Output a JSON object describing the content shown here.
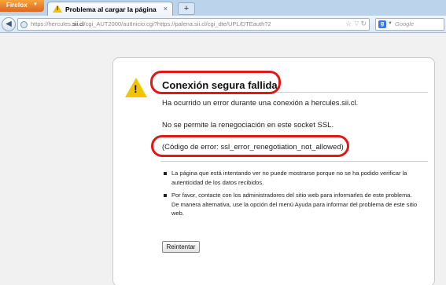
{
  "browser": {
    "app_button_label": "Firefox",
    "tab_title": "Problema al cargar la página",
    "new_tab_label": "+",
    "url_host_prefix": "https://hercules.",
    "url_host_bold": "sii.cl",
    "url_path": "/cgi_AUT2000/autInicio.cgi?https://palena.sii.cl/cgi_dte/UPL/DTEauth?2",
    "search_placeholder": "Google"
  },
  "error_page": {
    "title": "Conexión segura fallida",
    "line1": "Ha ocurrido un error durante una conexión a hercules.sii.cl.",
    "line2": "No se permite la renegociación en este socket SSL.",
    "error_code": "(Código de error: ssl_error_renegotiation_not_allowed)",
    "bullets": [
      "La página que está intentando ver no puede mostrarse porque no se ha podido verificar la autenticidad de los datos recibidos.",
      "Por favor, contacte con los administradores del sitio web para informarles de este problema. De manera alternativa, use la opción del menú Ayuda para informar del problema de este sitio web."
    ],
    "retry_label": "Reintentar"
  },
  "colors": {
    "highlight": "#e01818",
    "firefox_orange": "#e1661b",
    "warning_yellow": "#f2c400"
  }
}
